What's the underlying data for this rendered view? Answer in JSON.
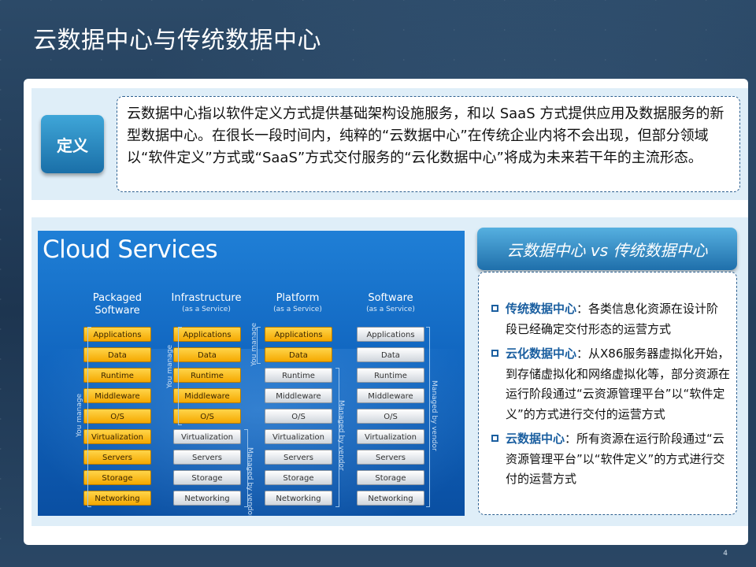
{
  "title": "云数据中心与传统数据中心",
  "definition": {
    "badge": "定义",
    "text": "云数据中心指以软件定义方式提供基础架构设施服务，和以 SaaS 方式提供应用及数据服务的新型数据中心。在很长一段时间内，纯粹的“云数据中心”在传统企业内将不会出现，但部分领域以“软件定义”方式或“SaaS”方式交付服务的“云化数据中心”将成为未来若干年的主流形态。"
  },
  "cloud_services": {
    "title": "Cloud Services",
    "columns": [
      {
        "name": "Packaged",
        "name2": "Software",
        "sub": ""
      },
      {
        "name": "Infrastructure",
        "name2": "",
        "sub": "(as a Service)"
      },
      {
        "name": "Platform",
        "name2": "",
        "sub": "(as a Service)"
      },
      {
        "name": "Software",
        "name2": "",
        "sub": "(as a Service)"
      }
    ],
    "layers": [
      "Applications",
      "Data",
      "Runtime",
      "Middleware",
      "O/S",
      "Virtualization",
      "Servers",
      "Storage",
      "Networking"
    ],
    "you_manage": "You manage",
    "managed_by_vendor": "Managed by vendor"
  },
  "comparison": {
    "header": "云数据中心 vs 传统数据中心",
    "items": [
      {
        "term": "传统数据中心",
        "desc": "：各类信息化资源在设计阶段已经确定交付形态的运营方式"
      },
      {
        "term": "云化数据中心",
        "desc": "：从X86服务器虚拟化开始，到存储虚拟化和网络虚拟化等，部分资源在运行阶段通过“云资源管理平台”以“软件定义”的方式进行交付的运营方式"
      },
      {
        "term": "云数据中心",
        "desc": "：所有资源在运行阶段通过“云资源管理平台”以“软件定义”的方式进行交付的运营方式"
      }
    ]
  },
  "page_number": "4",
  "colors": {
    "accent": "#1b5fa0",
    "user_layer": "#f5a800",
    "vendor_layer": "#cfd5dc",
    "panel_bg": "#dfeef8"
  }
}
